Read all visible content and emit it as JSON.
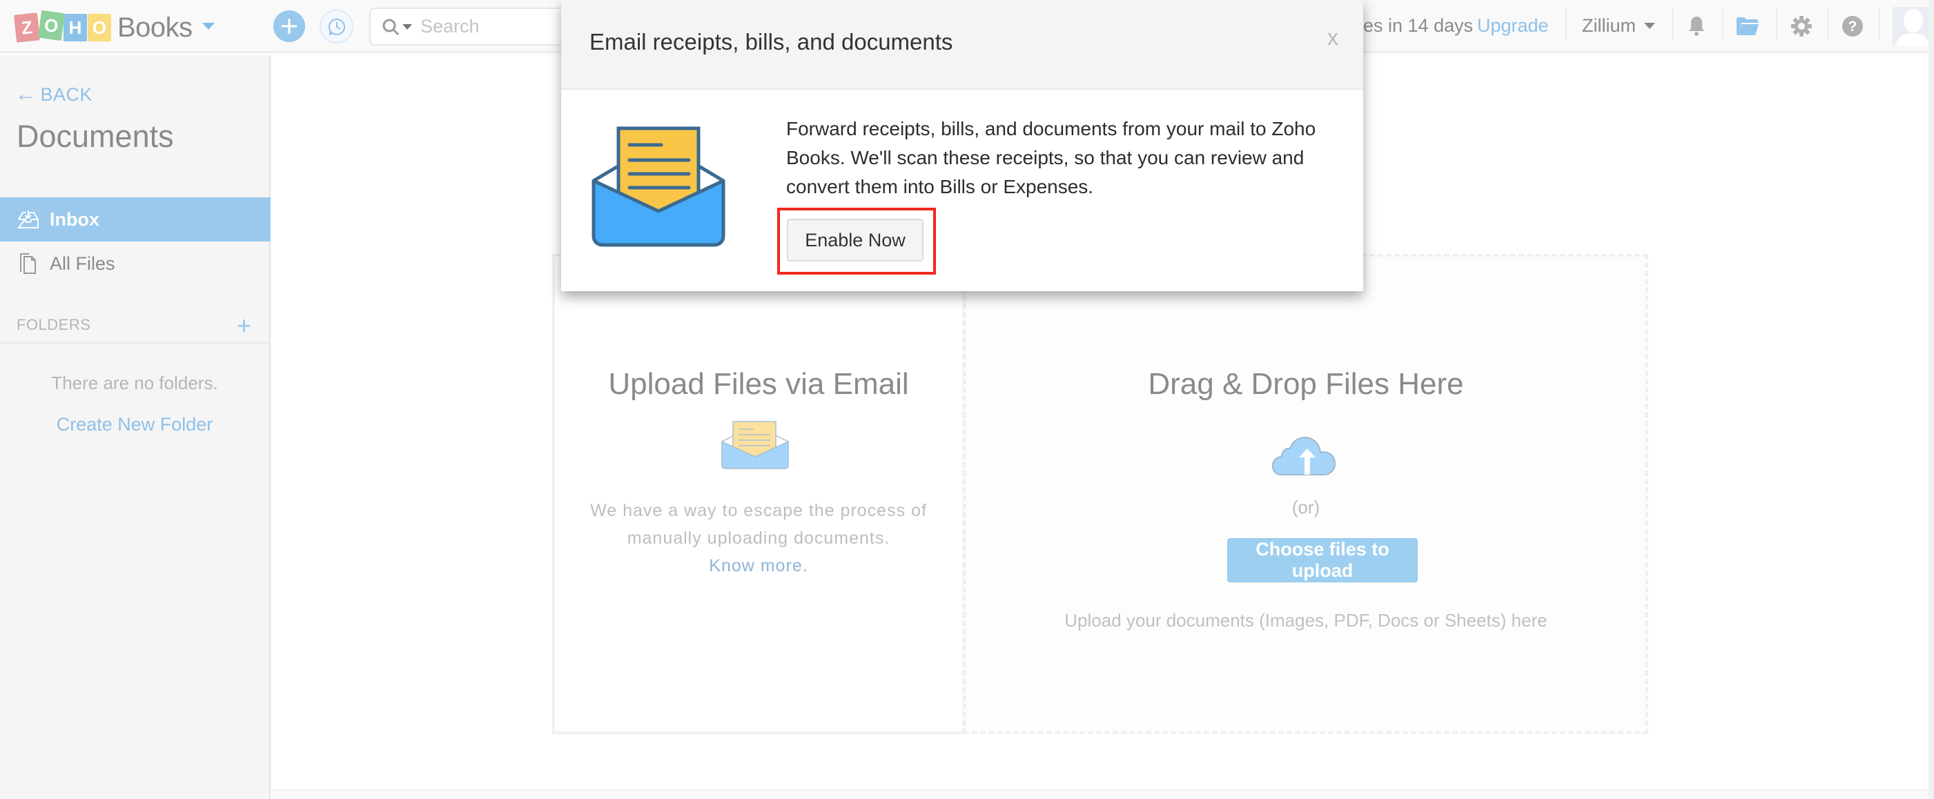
{
  "topbar": {
    "logo_letters": [
      "Z",
      "O",
      "H",
      "O"
    ],
    "brand": "Books",
    "search_placeholder": "Search",
    "trial_text": "es in 14 days",
    "upgrade_label": "Upgrade",
    "org_name": "Zillium",
    "icons": [
      "add-icon",
      "history-icon",
      "search-icon",
      "bell-icon",
      "folder-icon",
      "gear-icon",
      "help-icon",
      "avatar-icon"
    ]
  },
  "sidebar": {
    "back_label": "BACK",
    "title": "Documents",
    "items": [
      {
        "label": "Inbox",
        "icon": "inbox-icon",
        "active": true
      },
      {
        "label": "All Files",
        "icon": "files-icon",
        "active": false
      }
    ],
    "folders_label": "FOLDERS",
    "folders_add": "+",
    "no_folders_text": "There are no folders.",
    "create_folder_label": "Create New Folder"
  },
  "main": {
    "email_panel": {
      "title": "Upload Files via Email",
      "description": "We have a way to escape the process of manually uploading documents.",
      "link_label": "Know more."
    },
    "drop_panel": {
      "title": "Drag & Drop Files Here",
      "or_text": "(or)",
      "button_label": "Choose files to upload",
      "hint": "Upload your documents (Images, PDF, Docs or Sheets) here"
    }
  },
  "modal": {
    "title": "Email receipts, bills, and documents",
    "close_label": "x",
    "body_text": "Forward receipts, bills, and documents from your mail to Zoho Books. We'll scan these receipts, so that you can review and convert them into Bills or Expenses.",
    "button_label": "Enable Now"
  },
  "colors": {
    "accent": "#9ac9ed",
    "link": "#8fc0e8",
    "highlight": "#f0291e",
    "envelope_yellow": "#f9c546",
    "envelope_blue": "#46abf9",
    "envelope_stroke": "#3b6a90"
  }
}
